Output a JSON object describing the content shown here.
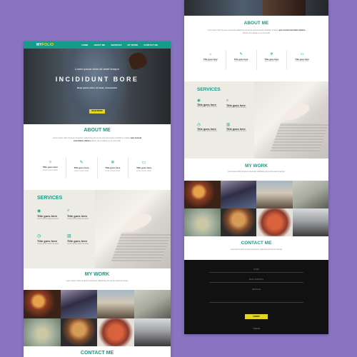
{
  "colors": {
    "background": "#8a74c2",
    "accent": "#159b8a",
    "button": "#e2d524",
    "dark": "#111111"
  },
  "nav": {
    "logo_main": "MY",
    "logo_accent": "FOLIO",
    "links": [
      "HOME",
      "ABOUT ME",
      "SERVICES",
      "MY WORK",
      "CONTACT ME"
    ]
  },
  "hero": {
    "tagline": "Lorem ipsum dolor sit amet tempor",
    "title": "INCIDIDUNT BORE",
    "subtitle": "Beae ipsum dolor sit amet, consectetur",
    "button": "READ MORE"
  },
  "about": {
    "title": "ABOUT ME",
    "text_start": "Lorem ipsum dolor sit amet consectetur adipisicing elit sed do eiusmod tempor incididunt ut labore",
    "text_bold": "quis nostrud exercitation ullamco",
    "text_end": "laboris nisi ut aliquip ex ea commodo",
    "features": [
      {
        "icon": "lightbulb-icon",
        "glyph": "☼",
        "title": "Title goes here",
        "desc": "Lorem ipsum dolor"
      },
      {
        "icon": "pencil-icon",
        "glyph": "✎",
        "title": "Title goes here",
        "desc": "Lorem ipsum dolor"
      },
      {
        "icon": "gear-icon",
        "glyph": "✲",
        "title": "Title goes here",
        "desc": "Lorem ipsum dolor"
      },
      {
        "icon": "monitor-icon",
        "glyph": "▭",
        "title": "Title goes here",
        "desc": "Lorem ipsum dolor"
      }
    ]
  },
  "services": {
    "title": "SERVICES",
    "items": [
      {
        "icon": "globe-icon",
        "glyph": "◉",
        "title": "Title goes here",
        "desc": "Lorem ipsum dolor sit amet"
      },
      {
        "icon": "search-icon",
        "glyph": "⌕",
        "title": "Title goes here",
        "desc": "Lorem ipsum dolor sit amet"
      },
      {
        "icon": "clock-icon",
        "glyph": "◷",
        "title": "Title goes here",
        "desc": "Lorem ipsum dolor sit amet"
      },
      {
        "icon": "chart-icon",
        "glyph": "▥",
        "title": "Title goes here",
        "desc": "Lorem ipsum dolor sit amet"
      }
    ]
  },
  "work": {
    "title": "MY WORK",
    "text": "Lorem ipsum dolor sit amet consectetur adipisicing elit sed do eiusmod tempor"
  },
  "contact": {
    "title": "CONTACT ME",
    "text": "Lorem ipsum dolor sit amet consectetur adipisicing elit sed do eiusmod",
    "fields": [
      "NAME",
      "EMAIL ADDRESS",
      "MESSAGE"
    ],
    "button": "SUBMIT",
    "footer": "© MyFolio"
  }
}
